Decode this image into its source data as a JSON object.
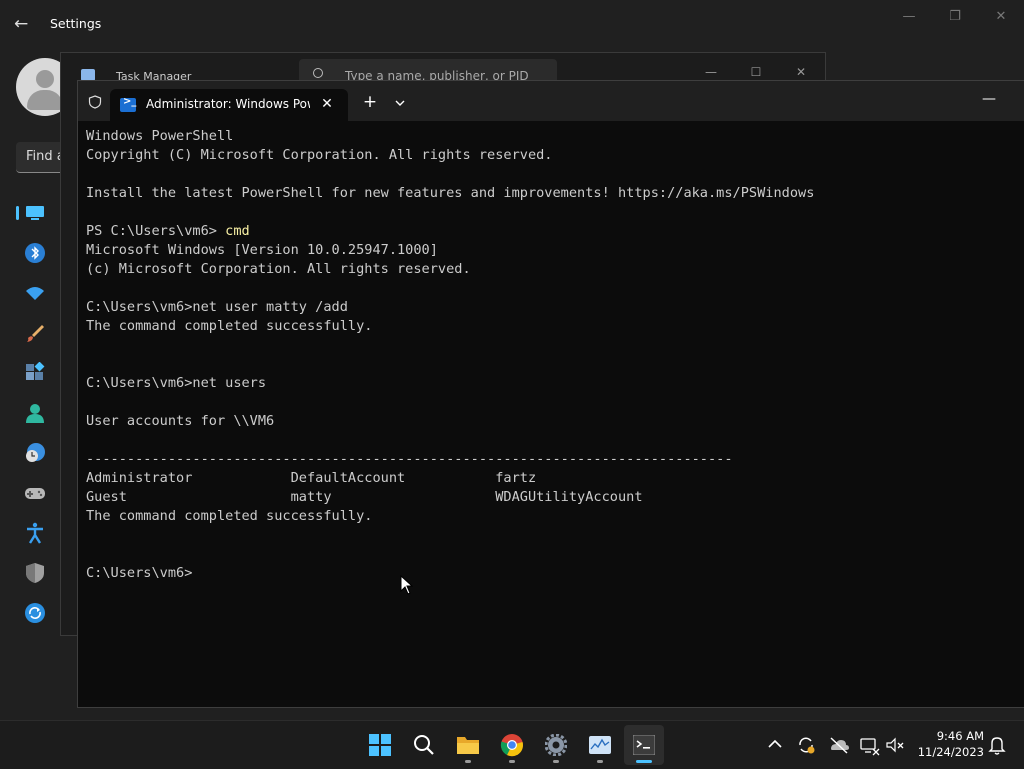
{
  "settings": {
    "title": "Settings",
    "back_glyph": "←",
    "search_text": "Find a"
  },
  "task_manager": {
    "title": "Task Manager",
    "search_placeholder": "Type a name, publisher, or PID"
  },
  "terminal": {
    "tab_title": "Administrator: Windows PowerShell",
    "new_tab_glyph": "+",
    "close_glyph": "✕",
    "minimize_glyph": "—",
    "lines": [
      {
        "text": "Windows PowerShell"
      },
      {
        "text": "Copyright (C) Microsoft Corporation. All rights reserved."
      },
      {
        "text": ""
      },
      {
        "text": "Install the latest PowerShell for new features and improvements! https://aka.ms/PSWindows"
      },
      {
        "text": ""
      },
      {
        "prompt": "PS C:\\Users\\vm6> ",
        "command": "cmd"
      },
      {
        "text": "Microsoft Windows [Version 10.0.25947.1000]"
      },
      {
        "text": "(c) Microsoft Corporation. All rights reserved."
      },
      {
        "text": ""
      },
      {
        "text": "C:\\Users\\vm6>net user matty /add"
      },
      {
        "text": "The command completed successfully."
      },
      {
        "text": ""
      },
      {
        "text": ""
      },
      {
        "text": "C:\\Users\\vm6>net users"
      },
      {
        "text": ""
      },
      {
        "text": "User accounts for \\\\VM6"
      },
      {
        "text": ""
      },
      {
        "text": "-------------------------------------------------------------------------------"
      },
      {
        "text": "Administrator            DefaultAccount           fartz"
      },
      {
        "text": "Guest                    matty                    WDAGUtilityAccount"
      },
      {
        "text": "The command completed successfully."
      },
      {
        "text": ""
      },
      {
        "text": ""
      },
      {
        "text": "C:\\Users\\vm6>"
      }
    ]
  },
  "taskbar": {
    "time": "9:46 AM",
    "date": "11/24/2023",
    "apps": [
      "start-icon",
      "search-icon",
      "file-explorer-icon",
      "chrome-icon",
      "settings-icon",
      "task-manager-icon",
      "terminal-icon"
    ]
  },
  "colors": {
    "accent": "#4cc2ff",
    "console_text": "#cccccc",
    "command_highlight": "#f9f1a5",
    "console_bg": "#0c0c0c"
  }
}
